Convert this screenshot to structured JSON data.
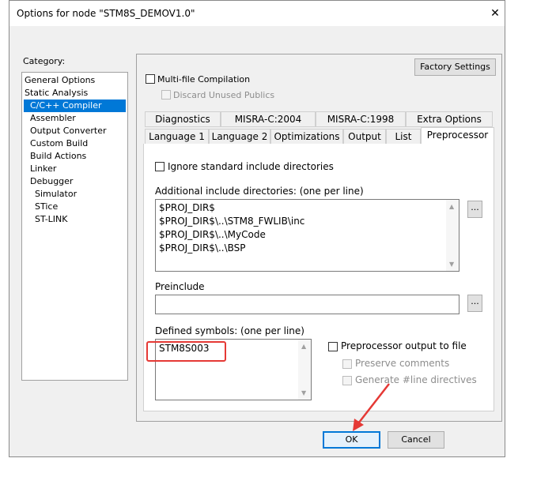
{
  "window": {
    "title": "Options for node \"STM8S_DEMOV1.0\"",
    "close_glyph": "✕"
  },
  "category": {
    "label": "Category:",
    "items": [
      "General Options",
      "Static Analysis",
      "C/C++ Compiler",
      "Assembler",
      "Output Converter",
      "Custom Build",
      "Build Actions",
      "Linker",
      "Debugger",
      "Simulator",
      "STice",
      "ST-LINK"
    ],
    "selected": "C/C++ Compiler"
  },
  "factory_settings_label": "Factory Settings",
  "multifile": {
    "label": "Multi-file Compilation",
    "checked": false
  },
  "discard_unused": {
    "label": "Discard Unused Publics",
    "checked": false,
    "enabled": false
  },
  "tabs_row1": [
    "Diagnostics",
    "MISRA-C:2004",
    "MISRA-C:1998",
    "Extra Options"
  ],
  "tabs_row2": [
    "Language 1",
    "Language 2",
    "Optimizations",
    "Output",
    "List",
    "Preprocessor"
  ],
  "active_tab": "Preprocessor",
  "preprocessor": {
    "ignore_std_label": "Ignore standard include directories",
    "ignore_std_checked": false,
    "include_dirs_label": "Additional include directories: (one per line)",
    "include_dirs": [
      "$PROJ_DIR$",
      "$PROJ_DIR$\\..\\STM8_FWLIB\\inc",
      "$PROJ_DIR$\\..\\MyCode",
      "$PROJ_DIR$\\..\\BSP"
    ],
    "browse_label": "...",
    "preinclude_label": "Preinclude",
    "preinclude_value": "",
    "defined_symbols_label": "Defined symbols: (one per line)",
    "defined_symbols": [
      "STM8S003"
    ],
    "pp_output_label": "Preprocessor output to file",
    "pp_output_checked": false,
    "preserve_comments_label": "Preserve comments",
    "generate_line_label": "Generate #line directives"
  },
  "buttons": {
    "ok": "OK",
    "cancel": "Cancel"
  },
  "annotation_color": "#e53935",
  "accent_color": "#0078d7"
}
